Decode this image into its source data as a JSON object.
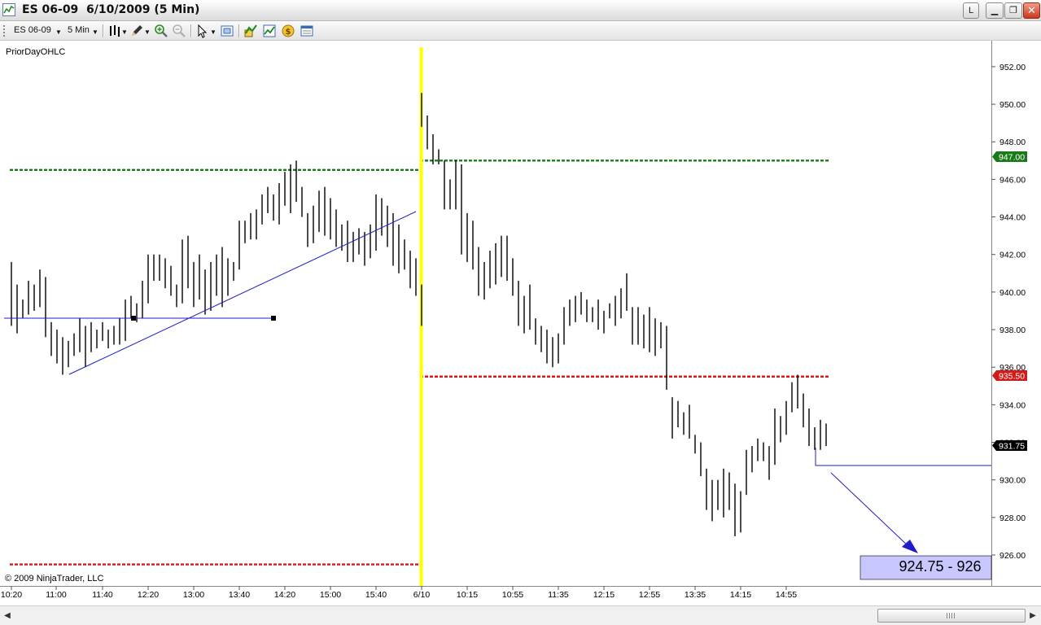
{
  "window": {
    "title": "ES 06-09  6/10/2009 (5 Min)",
    "buttons": {
      "layout": "L",
      "minimize": "▁",
      "maximize": "❐",
      "close": "✕"
    }
  },
  "toolbar": {
    "instrument": "ES 06-09",
    "interval": "5 Min",
    "icons": [
      "bar-type-icon",
      "draw-pencil-icon",
      "zoom-in-icon",
      "zoom-out-icon",
      "cursor-icon",
      "data-box-icon",
      "indicators-icon",
      "strategies-icon",
      "currency-icon",
      "properties-icon"
    ]
  },
  "chart": {
    "indicator_label": "PriorDayOHLC",
    "copyright": "© 2009 NinjaTrader, LLC",
    "callout_text": "924.75 - 926",
    "price_labels": {
      "green": "947.00",
      "red": "935.50",
      "last": "931.75"
    },
    "colors": {
      "green_level": "#1a7a1a",
      "red_level": "#d21c1c",
      "session_divider": "#ffff00",
      "trendline": "#1e1ec8",
      "last_price_bg": "#000000",
      "callout_bg": "#c8c8ff"
    }
  },
  "chart_data": {
    "type": "bar",
    "title": "",
    "ylim": [
      924.5,
      953
    ],
    "y_ticks": [
      "926.00",
      "928.00",
      "930.00",
      "932.00",
      "934.00",
      "936.00",
      "938.00",
      "940.00",
      "942.00",
      "944.00",
      "946.00",
      "948.00",
      "950.00",
      "952.00"
    ],
    "x_ticks": [
      "10:20",
      "11:00",
      "11:40",
      "12:20",
      "13:00",
      "13:40",
      "14:20",
      "15:00",
      "15:40",
      "6/10",
      "10:15",
      "10:55",
      "11:35",
      "12:15",
      "12:55",
      "13:35",
      "14:15",
      "14:55"
    ],
    "levels": [
      {
        "name": "prior-day-high",
        "value": 946.5,
        "session": "6/9"
      },
      {
        "name": "prior-day-low",
        "value": 925.5,
        "session": "6/9"
      },
      {
        "name": "prior-day-high",
        "value": 947.0,
        "session": "6/10"
      },
      {
        "name": "prior-day-low",
        "value": 935.5,
        "session": "6/10"
      }
    ],
    "session_break": "6/10",
    "bars_day1": [
      {
        "h": 941.6,
        "l": 938.2
      },
      {
        "h": 940.4,
        "l": 937.8
      },
      {
        "h": 939.6,
        "l": 938.6
      },
      {
        "h": 940.6,
        "l": 938.8
      },
      {
        "h": 940.4,
        "l": 939.0
      },
      {
        "h": 941.2,
        "l": 939.2
      },
      {
        "h": 940.8,
        "l": 937.6
      },
      {
        "h": 938.4,
        "l": 936.6
      },
      {
        "h": 938.0,
        "l": 936.2
      },
      {
        "h": 937.6,
        "l": 935.6
      },
      {
        "h": 937.4,
        "l": 936.0
      },
      {
        "h": 937.8,
        "l": 936.6
      },
      {
        "h": 938.6,
        "l": 936.8
      },
      {
        "h": 938.2,
        "l": 936.0
      },
      {
        "h": 938.4,
        "l": 936.8
      },
      {
        "h": 938.0,
        "l": 937.0
      },
      {
        "h": 938.4,
        "l": 937.4
      },
      {
        "h": 938.0,
        "l": 937.0
      },
      {
        "h": 938.2,
        "l": 937.2
      },
      {
        "h": 938.6,
        "l": 937.2
      },
      {
        "h": 939.6,
        "l": 937.4
      },
      {
        "h": 939.8,
        "l": 938.6
      },
      {
        "h": 939.4,
        "l": 938.4
      },
      {
        "h": 940.6,
        "l": 938.6
      },
      {
        "h": 942.0,
        "l": 939.4
      },
      {
        "h": 942.0,
        "l": 940.6
      },
      {
        "h": 942.0,
        "l": 940.6
      },
      {
        "h": 941.8,
        "l": 940.2
      },
      {
        "h": 941.4,
        "l": 939.8
      },
      {
        "h": 940.4,
        "l": 939.2
      },
      {
        "h": 942.8,
        "l": 939.4
      },
      {
        "h": 943.0,
        "l": 940.2
      },
      {
        "h": 941.6,
        "l": 939.2
      },
      {
        "h": 942.0,
        "l": 939.6
      },
      {
        "h": 941.2,
        "l": 938.8
      },
      {
        "h": 941.6,
        "l": 939.0
      },
      {
        "h": 942.0,
        "l": 939.8
      },
      {
        "h": 942.4,
        "l": 939.2
      },
      {
        "h": 941.8,
        "l": 939.8
      },
      {
        "h": 941.6,
        "l": 940.6
      },
      {
        "h": 943.8,
        "l": 941.2
      },
      {
        "h": 943.8,
        "l": 942.6
      },
      {
        "h": 944.2,
        "l": 942.8
      },
      {
        "h": 944.4,
        "l": 942.8
      },
      {
        "h": 945.2,
        "l": 943.6
      },
      {
        "h": 945.6,
        "l": 944.2
      },
      {
        "h": 945.2,
        "l": 943.8
      },
      {
        "h": 945.8,
        "l": 943.6
      },
      {
        "h": 946.4,
        "l": 944.6
      },
      {
        "h": 946.8,
        "l": 944.2
      },
      {
        "h": 947.0,
        "l": 944.8
      },
      {
        "h": 945.6,
        "l": 944.0
      },
      {
        "h": 944.2,
        "l": 942.4
      },
      {
        "h": 944.6,
        "l": 942.6
      },
      {
        "h": 945.4,
        "l": 943.2
      },
      {
        "h": 945.6,
        "l": 943.0
      },
      {
        "h": 945.0,
        "l": 942.8
      },
      {
        "h": 944.4,
        "l": 942.4
      },
      {
        "h": 943.6,
        "l": 942.2
      },
      {
        "h": 943.8,
        "l": 941.6
      },
      {
        "h": 943.2,
        "l": 941.6
      },
      {
        "h": 943.4,
        "l": 942.0
      },
      {
        "h": 943.2,
        "l": 941.4
      },
      {
        "h": 943.6,
        "l": 941.8
      },
      {
        "h": 945.2,
        "l": 942.2
      },
      {
        "h": 945.0,
        "l": 943.0
      },
      {
        "h": 944.6,
        "l": 942.4
      },
      {
        "h": 944.2,
        "l": 941.4
      },
      {
        "h": 943.6,
        "l": 941.0
      },
      {
        "h": 942.8,
        "l": 941.2
      },
      {
        "h": 942.2,
        "l": 940.2
      },
      {
        "h": 941.8,
        "l": 939.8
      },
      {
        "h": 940.4,
        "l": 938.2
      }
    ],
    "bars_day2": [
      {
        "h": 950.6,
        "l": 948.8
      },
      {
        "h": 949.4,
        "l": 947.6
      },
      {
        "h": 948.4,
        "l": 946.8
      },
      {
        "h": 947.6,
        "l": 946.8
      },
      {
        "h": 947.0,
        "l": 944.4
      },
      {
        "h": 946.0,
        "l": 944.4
      },
      {
        "h": 947.0,
        "l": 944.4
      },
      {
        "h": 946.8,
        "l": 942.0
      },
      {
        "h": 944.2,
        "l": 941.6
      },
      {
        "h": 943.8,
        "l": 941.2
      },
      {
        "h": 942.4,
        "l": 939.8
      },
      {
        "h": 941.6,
        "l": 939.6
      },
      {
        "h": 942.2,
        "l": 940.2
      },
      {
        "h": 942.6,
        "l": 940.4
      },
      {
        "h": 943.0,
        "l": 940.8
      },
      {
        "h": 943.0,
        "l": 940.6
      },
      {
        "h": 941.8,
        "l": 939.8
      },
      {
        "h": 940.6,
        "l": 938.2
      },
      {
        "h": 939.8,
        "l": 937.8
      },
      {
        "h": 940.4,
        "l": 938.0
      },
      {
        "h": 938.6,
        "l": 937.2
      },
      {
        "h": 938.2,
        "l": 936.8
      },
      {
        "h": 938.0,
        "l": 936.2
      },
      {
        "h": 937.6,
        "l": 936.0
      },
      {
        "h": 937.8,
        "l": 936.2
      },
      {
        "h": 939.2,
        "l": 937.2
      },
      {
        "h": 939.6,
        "l": 938.2
      },
      {
        "h": 939.8,
        "l": 938.4
      },
      {
        "h": 940.0,
        "l": 938.8
      },
      {
        "h": 939.6,
        "l": 938.4
      },
      {
        "h": 939.2,
        "l": 938.4
      },
      {
        "h": 939.6,
        "l": 938.0
      },
      {
        "h": 939.0,
        "l": 937.8
      },
      {
        "h": 939.4,
        "l": 938.6
      },
      {
        "h": 939.8,
        "l": 938.2
      },
      {
        "h": 940.2,
        "l": 938.6
      },
      {
        "h": 941.0,
        "l": 939.0
      },
      {
        "h": 939.2,
        "l": 937.2
      },
      {
        "h": 939.2,
        "l": 937.2
      },
      {
        "h": 938.8,
        "l": 937.0
      },
      {
        "h": 939.2,
        "l": 936.8
      },
      {
        "h": 938.6,
        "l": 936.6
      },
      {
        "h": 938.4,
        "l": 937.0
      },
      {
        "h": 938.2,
        "l": 934.8
      },
      {
        "h": 934.4,
        "l": 932.2
      },
      {
        "h": 934.2,
        "l": 932.8
      },
      {
        "h": 933.6,
        "l": 932.4
      },
      {
        "h": 934.0,
        "l": 932.2
      },
      {
        "h": 932.4,
        "l": 931.4
      },
      {
        "h": 932.0,
        "l": 930.2
      },
      {
        "h": 930.6,
        "l": 928.4
      },
      {
        "h": 930.0,
        "l": 927.8
      },
      {
        "h": 930.0,
        "l": 928.4
      },
      {
        "h": 930.6,
        "l": 928.0
      },
      {
        "h": 930.4,
        "l": 928.4
      },
      {
        "h": 929.8,
        "l": 927.0
      },
      {
        "h": 929.4,
        "l": 927.2
      },
      {
        "h": 931.6,
        "l": 929.2
      },
      {
        "h": 931.8,
        "l": 930.4
      },
      {
        "h": 932.2,
        "l": 931.0
      },
      {
        "h": 932.0,
        "l": 931.0
      },
      {
        "h": 931.8,
        "l": 930.0
      },
      {
        "h": 933.8,
        "l": 930.8
      },
      {
        "h": 933.4,
        "l": 932.0
      },
      {
        "h": 934.2,
        "l": 932.4
      },
      {
        "h": 935.2,
        "l": 933.6
      },
      {
        "h": 935.6,
        "l": 933.8
      },
      {
        "h": 934.6,
        "l": 932.8
      },
      {
        "h": 933.8,
        "l": 931.8
      },
      {
        "h": 932.8,
        "l": 931.6
      },
      {
        "h": 933.2,
        "l": 931.6
      },
      {
        "h": 933.0,
        "l": 931.8
      }
    ]
  }
}
